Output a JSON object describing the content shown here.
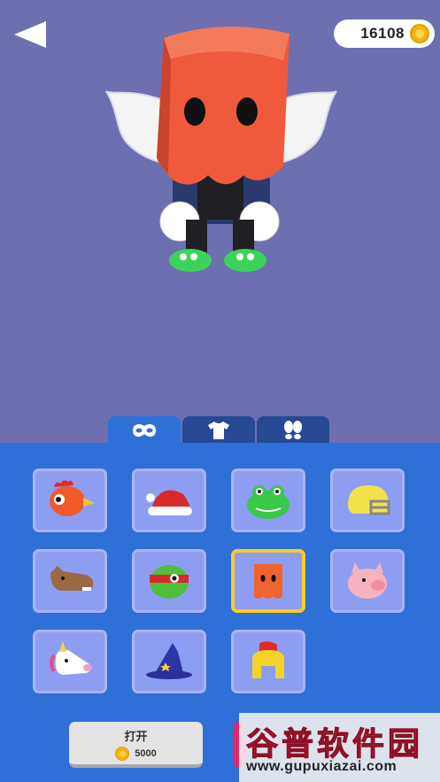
{
  "header": {
    "coins": "16108"
  },
  "tabs": [
    {
      "name": "masks",
      "icon": "mask-icon",
      "active": true
    },
    {
      "name": "clothes",
      "icon": "shirt-icon",
      "active": false
    },
    {
      "name": "shoes",
      "icon": "footprints-icon",
      "active": false
    }
  ],
  "items": [
    {
      "icon": "chicken-head-icon"
    },
    {
      "icon": "santa-hat-icon"
    },
    {
      "icon": "frog-head-icon"
    },
    {
      "icon": "football-helmet-icon"
    },
    {
      "icon": "horse-head-icon"
    },
    {
      "icon": "turtle-mask-icon"
    },
    {
      "icon": "orange-box-head-icon",
      "selected": true
    },
    {
      "icon": "pig-head-icon"
    },
    {
      "icon": "unicorn-head-icon"
    },
    {
      "icon": "wizard-hat-icon"
    },
    {
      "icon": "spartan-helmet-icon"
    }
  ],
  "buy": {
    "label": "打开",
    "price": "5000"
  },
  "watermark": {
    "main": "谷普软件园",
    "url": "www.gupuxiazai.com"
  },
  "colors": {
    "background": "#6d6fb1",
    "panel": "#2f6fd8",
    "tab_inactive": "#254a93",
    "selection": "#f7cd22",
    "coin": "#f3b40d"
  }
}
